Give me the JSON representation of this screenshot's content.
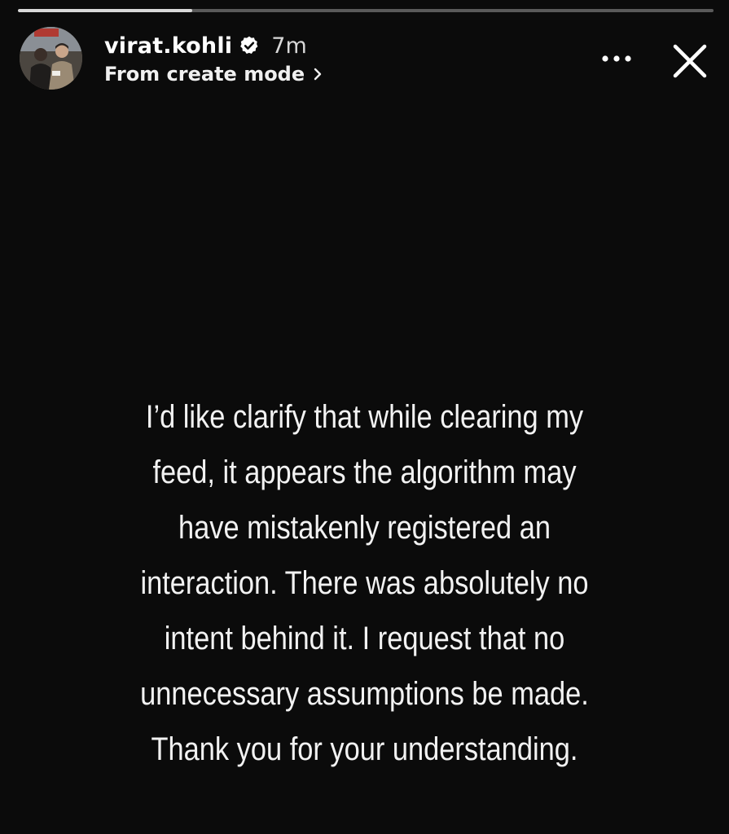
{
  "progress": 0.25,
  "header": {
    "username": "virat.kohli",
    "time": "7m",
    "subtitle": "From create mode",
    "verified_icon": "verified-badge-icon",
    "chevron_icon": "chevron-right-icon",
    "more_icon": "more-horizontal-icon",
    "close_icon": "close-icon"
  },
  "message": {
    "lines": [
      "I’d like clarify that while clearing my",
      "feed, it appears the algorithm may",
      "have mistakenly registered an",
      "interaction. There was absolutely no",
      "intent behind it. I request that no",
      "unnecessary assumptions be made.",
      "Thank you for your understanding."
    ]
  },
  "colors": {
    "background": "#0b0b0b",
    "text": "#f2f2f2",
    "progress_track": "#5a5a5a",
    "progress_fill": "#d9d9d9"
  }
}
